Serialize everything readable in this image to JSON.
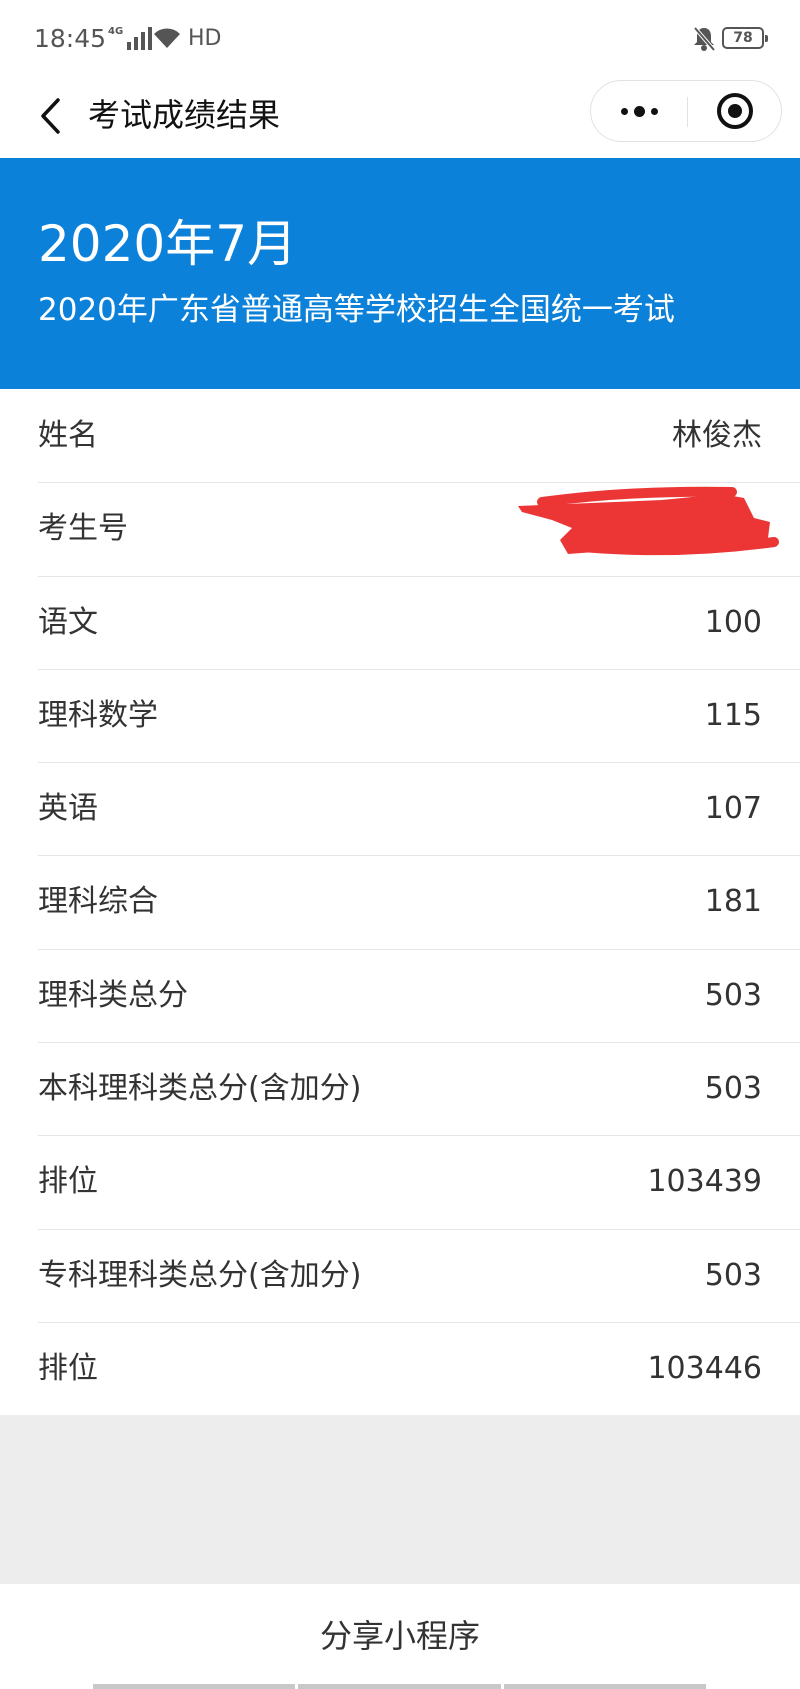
{
  "status_bar": {
    "time": "18:45",
    "network": "4G",
    "hd": "HD",
    "battery": "78"
  },
  "nav": {
    "title": "考试成绩结果"
  },
  "banner": {
    "title": "2020年7月",
    "subtitle": "2020年广东省普通高等学校招生全国统一考试",
    "color": "#0c81d9"
  },
  "results": [
    {
      "label": "姓名",
      "value": "林俊杰"
    },
    {
      "label": "考生号",
      "value": ""
    },
    {
      "label": "语文",
      "value": "100"
    },
    {
      "label": "理科数学",
      "value": "115"
    },
    {
      "label": "英语",
      "value": "107"
    },
    {
      "label": "理科综合",
      "value": "181"
    },
    {
      "label": "理科类总分",
      "value": "503"
    },
    {
      "label": "本科理科类总分(含加分)",
      "value": "503"
    },
    {
      "label": "排位",
      "value": "103439"
    },
    {
      "label": "专科理科类总分(含加分)",
      "value": "503"
    },
    {
      "label": "排位",
      "value": "103446"
    }
  ],
  "redaction_color": "#ec3636",
  "share": {
    "label": "分享小程序"
  }
}
